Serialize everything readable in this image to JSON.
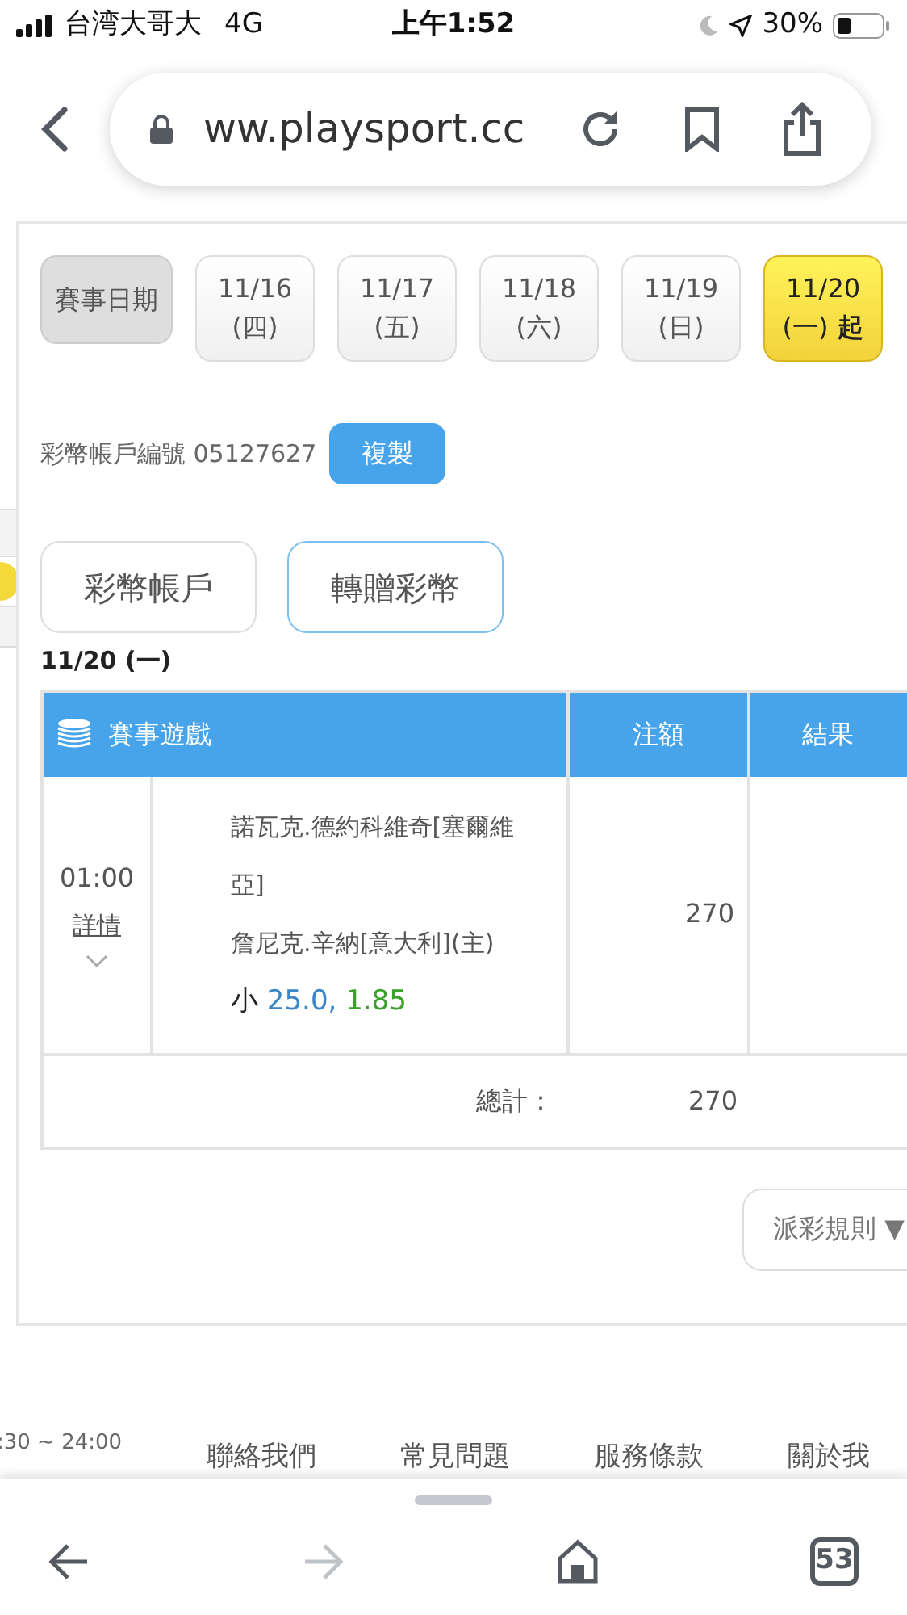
{
  "status_bar": {
    "carrier": "台湾大哥大",
    "network": "4G",
    "time": "上午1:52",
    "battery": "30%"
  },
  "browser": {
    "url": "ww.playsport.cc",
    "tab_count": "53"
  },
  "date_picker": {
    "label": "賽事日期",
    "dates": [
      {
        "date": "11/16",
        "weekday": "(四)",
        "selected": false
      },
      {
        "date": "11/17",
        "weekday": "(五)",
        "selected": false
      },
      {
        "date": "11/18",
        "weekday": "(六)",
        "selected": false
      },
      {
        "date": "11/19",
        "weekday": "(日)",
        "selected": false
      },
      {
        "date": "11/20",
        "weekday": "(一)",
        "suffix": "起",
        "selected": true
      }
    ]
  },
  "account": {
    "label": "彩幣帳戶編號 05127627",
    "copy_button": "複製"
  },
  "tabs": [
    {
      "label": "彩幣帳戶",
      "selected": false
    },
    {
      "label": "轉贈彩幣",
      "selected": true
    }
  ],
  "day_heading": "11/20 (一)",
  "table": {
    "columns": [
      "賽事遊戲",
      "注額",
      "結果"
    ],
    "rows": [
      {
        "time": "01:00",
        "details_link": "詳情",
        "teams": [
          "諾瓦克.德約科維奇[塞爾維亞]",
          "詹尼克.辛納[意大利](主)"
        ],
        "pick": "小",
        "line": "25.0,",
        "odds": "1.85",
        "stake": "270"
      }
    ],
    "total_label": "總計：",
    "total": "270"
  },
  "rules_button": "派彩規則 ▼",
  "footer": {
    "hours": ":30 ~ 24:00",
    "links": [
      "聯絡我們",
      "常見問題",
      "服務條款",
      "關於我"
    ]
  }
}
